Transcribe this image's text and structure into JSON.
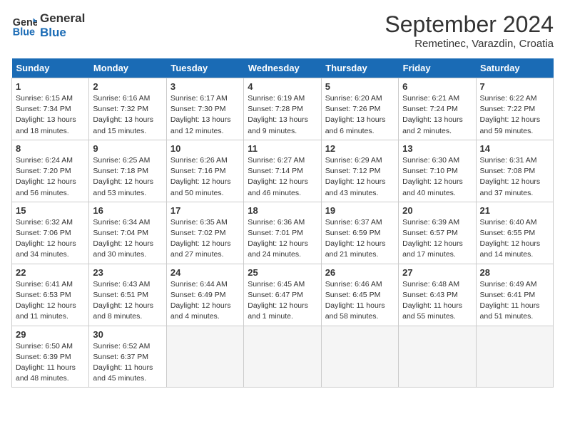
{
  "header": {
    "logo_line1": "General",
    "logo_line2": "Blue",
    "month": "September 2024",
    "location": "Remetinec, Varazdin, Croatia"
  },
  "weekdays": [
    "Sunday",
    "Monday",
    "Tuesday",
    "Wednesday",
    "Thursday",
    "Friday",
    "Saturday"
  ],
  "weeks": [
    [
      {
        "day": 1,
        "sunrise": "6:15 AM",
        "sunset": "7:34 PM",
        "daylight": "13 hours and 18 minutes."
      },
      {
        "day": 2,
        "sunrise": "6:16 AM",
        "sunset": "7:32 PM",
        "daylight": "13 hours and 15 minutes."
      },
      {
        "day": 3,
        "sunrise": "6:17 AM",
        "sunset": "7:30 PM",
        "daylight": "13 hours and 12 minutes."
      },
      {
        "day": 4,
        "sunrise": "6:19 AM",
        "sunset": "7:28 PM",
        "daylight": "13 hours and 9 minutes."
      },
      {
        "day": 5,
        "sunrise": "6:20 AM",
        "sunset": "7:26 PM",
        "daylight": "13 hours and 6 minutes."
      },
      {
        "day": 6,
        "sunrise": "6:21 AM",
        "sunset": "7:24 PM",
        "daylight": "13 hours and 2 minutes."
      },
      {
        "day": 7,
        "sunrise": "6:22 AM",
        "sunset": "7:22 PM",
        "daylight": "12 hours and 59 minutes."
      }
    ],
    [
      {
        "day": 8,
        "sunrise": "6:24 AM",
        "sunset": "7:20 PM",
        "daylight": "12 hours and 56 minutes."
      },
      {
        "day": 9,
        "sunrise": "6:25 AM",
        "sunset": "7:18 PM",
        "daylight": "12 hours and 53 minutes."
      },
      {
        "day": 10,
        "sunrise": "6:26 AM",
        "sunset": "7:16 PM",
        "daylight": "12 hours and 50 minutes."
      },
      {
        "day": 11,
        "sunrise": "6:27 AM",
        "sunset": "7:14 PM",
        "daylight": "12 hours and 46 minutes."
      },
      {
        "day": 12,
        "sunrise": "6:29 AM",
        "sunset": "7:12 PM",
        "daylight": "12 hours and 43 minutes."
      },
      {
        "day": 13,
        "sunrise": "6:30 AM",
        "sunset": "7:10 PM",
        "daylight": "12 hours and 40 minutes."
      },
      {
        "day": 14,
        "sunrise": "6:31 AM",
        "sunset": "7:08 PM",
        "daylight": "12 hours and 37 minutes."
      }
    ],
    [
      {
        "day": 15,
        "sunrise": "6:32 AM",
        "sunset": "7:06 PM",
        "daylight": "12 hours and 34 minutes."
      },
      {
        "day": 16,
        "sunrise": "6:34 AM",
        "sunset": "7:04 PM",
        "daylight": "12 hours and 30 minutes."
      },
      {
        "day": 17,
        "sunrise": "6:35 AM",
        "sunset": "7:02 PM",
        "daylight": "12 hours and 27 minutes."
      },
      {
        "day": 18,
        "sunrise": "6:36 AM",
        "sunset": "7:01 PM",
        "daylight": "12 hours and 24 minutes."
      },
      {
        "day": 19,
        "sunrise": "6:37 AM",
        "sunset": "6:59 PM",
        "daylight": "12 hours and 21 minutes."
      },
      {
        "day": 20,
        "sunrise": "6:39 AM",
        "sunset": "6:57 PM",
        "daylight": "12 hours and 17 minutes."
      },
      {
        "day": 21,
        "sunrise": "6:40 AM",
        "sunset": "6:55 PM",
        "daylight": "12 hours and 14 minutes."
      }
    ],
    [
      {
        "day": 22,
        "sunrise": "6:41 AM",
        "sunset": "6:53 PM",
        "daylight": "12 hours and 11 minutes."
      },
      {
        "day": 23,
        "sunrise": "6:43 AM",
        "sunset": "6:51 PM",
        "daylight": "12 hours and 8 minutes."
      },
      {
        "day": 24,
        "sunrise": "6:44 AM",
        "sunset": "6:49 PM",
        "daylight": "12 hours and 4 minutes."
      },
      {
        "day": 25,
        "sunrise": "6:45 AM",
        "sunset": "6:47 PM",
        "daylight": "12 hours and 1 minute."
      },
      {
        "day": 26,
        "sunrise": "6:46 AM",
        "sunset": "6:45 PM",
        "daylight": "11 hours and 58 minutes."
      },
      {
        "day": 27,
        "sunrise": "6:48 AM",
        "sunset": "6:43 PM",
        "daylight": "11 hours and 55 minutes."
      },
      {
        "day": 28,
        "sunrise": "6:49 AM",
        "sunset": "6:41 PM",
        "daylight": "11 hours and 51 minutes."
      }
    ],
    [
      {
        "day": 29,
        "sunrise": "6:50 AM",
        "sunset": "6:39 PM",
        "daylight": "11 hours and 48 minutes."
      },
      {
        "day": 30,
        "sunrise": "6:52 AM",
        "sunset": "6:37 PM",
        "daylight": "11 hours and 45 minutes."
      },
      null,
      null,
      null,
      null,
      null
    ]
  ]
}
